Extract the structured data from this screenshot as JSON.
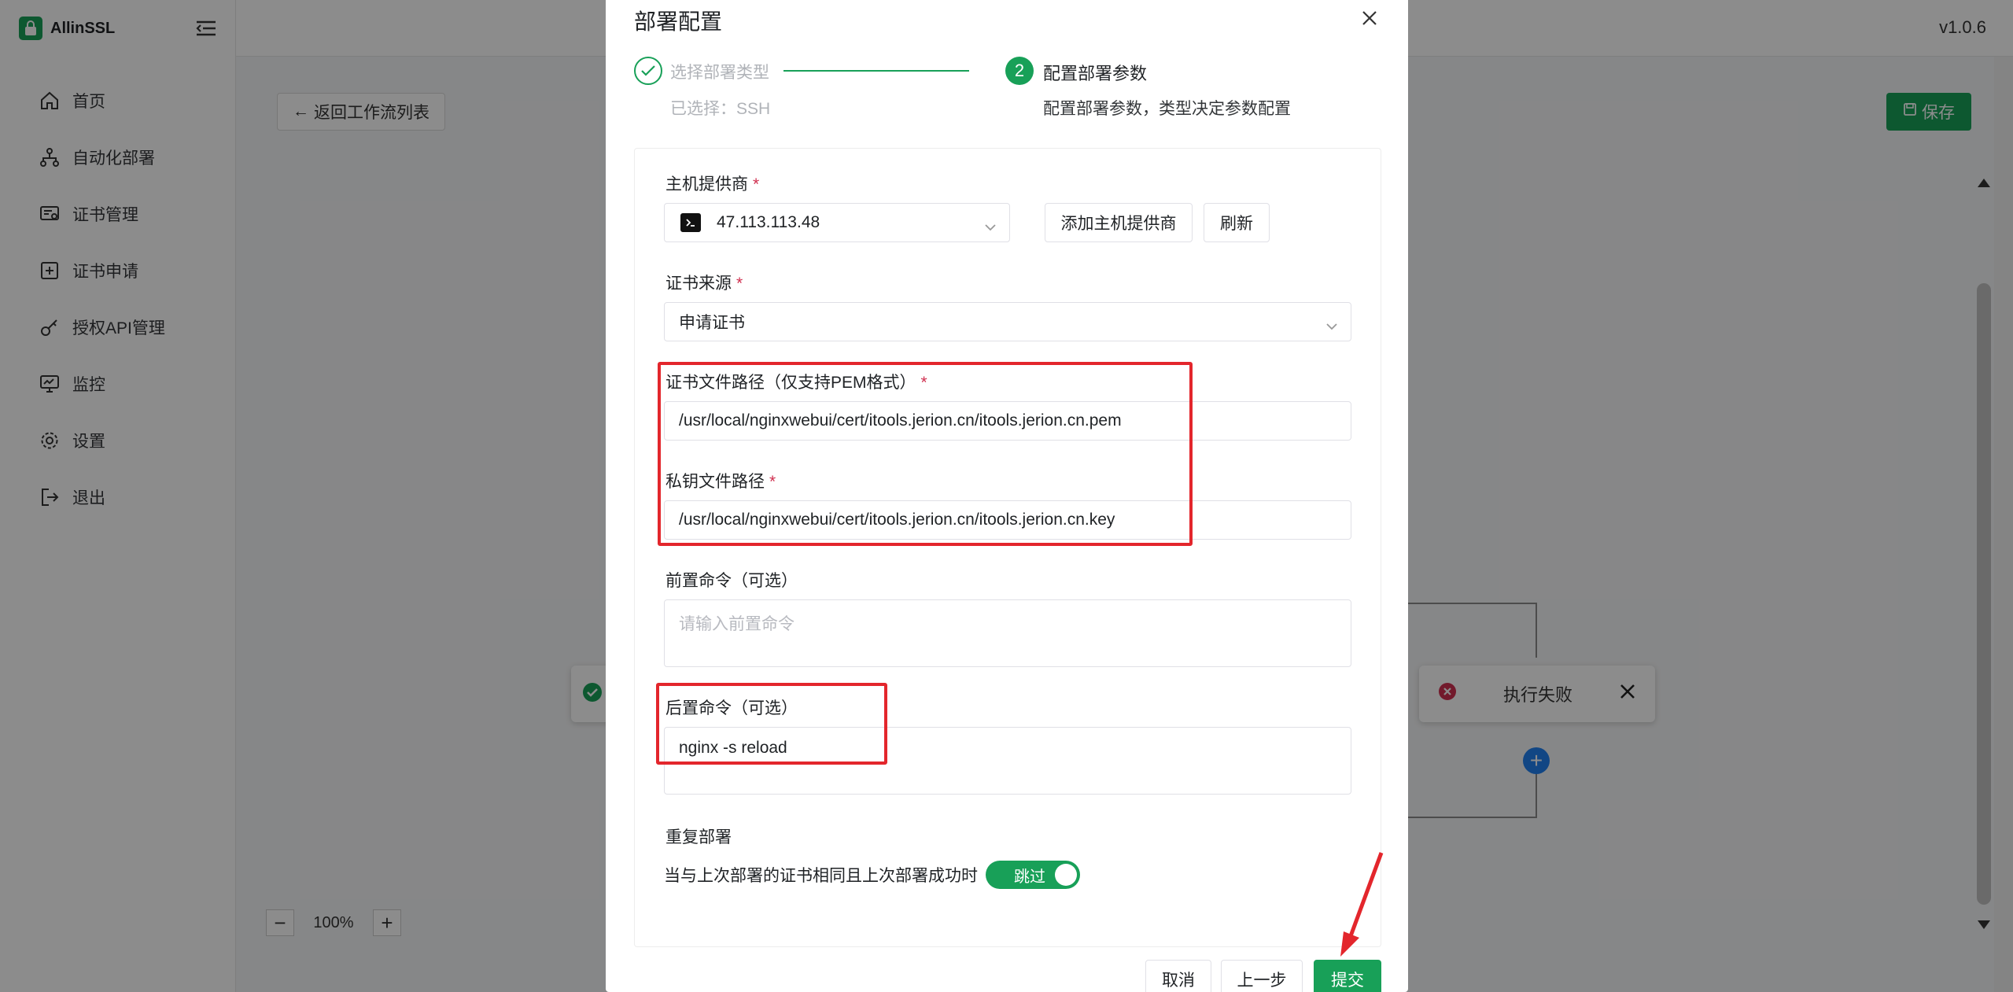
{
  "app": {
    "logo_text": "AllinSSL",
    "version": "v1.0.6"
  },
  "sidebar": {
    "items": [
      {
        "label": "首页",
        "icon": "home-icon"
      },
      {
        "label": "自动化部署",
        "icon": "workflow-icon"
      },
      {
        "label": "证书管理",
        "icon": "certificate-icon"
      },
      {
        "label": "证书申请",
        "icon": "plus-square-icon"
      },
      {
        "label": "授权API管理",
        "icon": "key-icon"
      },
      {
        "label": "监控",
        "icon": "monitor-icon"
      },
      {
        "label": "设置",
        "icon": "gear-icon"
      },
      {
        "label": "退出",
        "icon": "logout-icon"
      }
    ]
  },
  "toolbar": {
    "back_label": "返回工作流列表",
    "save_label": "保存"
  },
  "canvas": {
    "zoom_level": "100%",
    "fail_node_label": "执行失败"
  },
  "modal": {
    "title": "部署配置",
    "steps": [
      {
        "index": "1",
        "title": "选择部署类型",
        "desc": "已选择：SSH",
        "state": "done"
      },
      {
        "index": "2",
        "title": "配置部署参数",
        "desc": "配置部署参数，类型决定参数配置",
        "state": "active"
      }
    ],
    "form": {
      "host_provider_label": "主机提供商",
      "host_provider_value": "47.113.113.48",
      "add_host_button": "添加主机提供商",
      "refresh_button": "刷新",
      "cert_source_label": "证书来源",
      "cert_source_value": "申请证书",
      "cert_path_label": "证书文件路径（仅支持PEM格式）",
      "cert_path_value": "/usr/local/nginxwebui/cert/itools.jerion.cn/itools.jerion.cn.pem",
      "key_path_label": "私钥文件路径",
      "key_path_value": "/usr/local/nginxwebui/cert/itools.jerion.cn/itools.jerion.cn.key",
      "pre_cmd_label": "前置命令（可选）",
      "pre_cmd_placeholder": "请输入前置命令",
      "post_cmd_label": "后置命令（可选）",
      "post_cmd_value": "nginx -s reload",
      "redeploy_label": "重复部署",
      "redeploy_desc": "当与上次部署的证书相同且上次部署成功时",
      "redeploy_switch": "跳过",
      "required_mark": "*"
    },
    "footer": {
      "cancel": "取消",
      "prev": "上一步",
      "submit": "提交"
    }
  },
  "colors": {
    "accent": "#18a058",
    "highlight_box": "#e3262c",
    "error": "#d03050",
    "link_blue": "#2080f0"
  }
}
